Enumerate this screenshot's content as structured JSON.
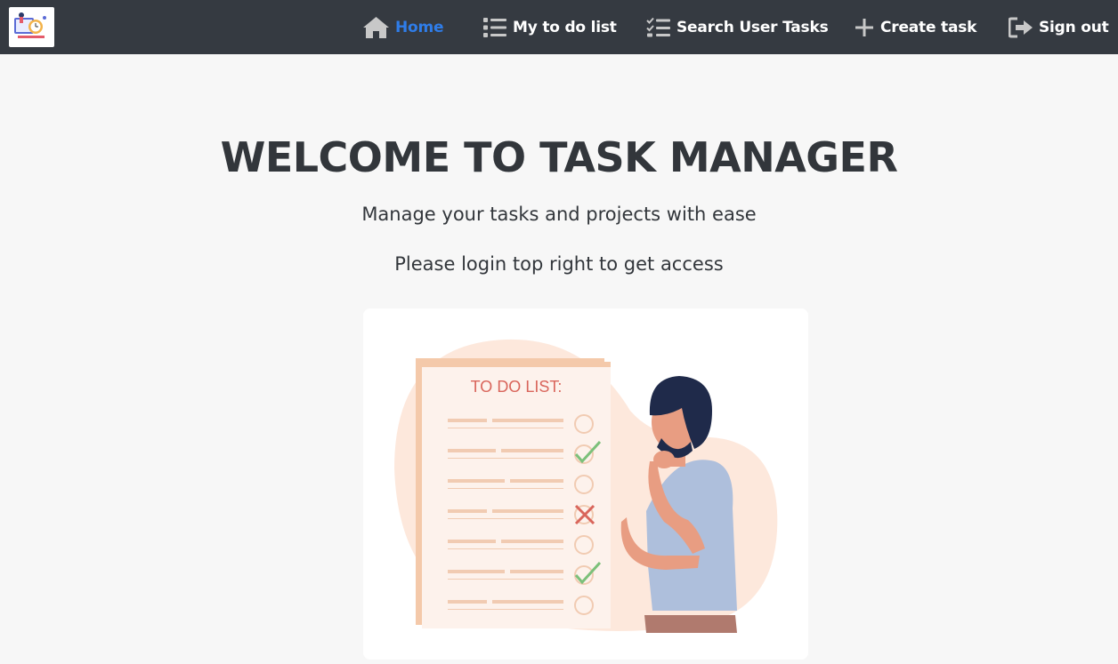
{
  "nav": {
    "home": "Home",
    "todo": "My to do list",
    "search": "Search User Tasks",
    "create": "Create task",
    "signout": "Sign out"
  },
  "hero": {
    "title": "WELCOME TO TASK MANAGER",
    "subtitle": "Manage your tasks and projects with ease",
    "login_hint": "Please login top right to get access"
  },
  "illustration": {
    "heading": "TO DO LIST:",
    "items": [
      "empty",
      "checked",
      "empty",
      "crossed",
      "empty",
      "checked",
      "empty"
    ]
  },
  "colors": {
    "navbar": "#353a41",
    "active_link": "#2f7de9",
    "text": "#32363b",
    "page_bg": "#f7f7f7"
  }
}
